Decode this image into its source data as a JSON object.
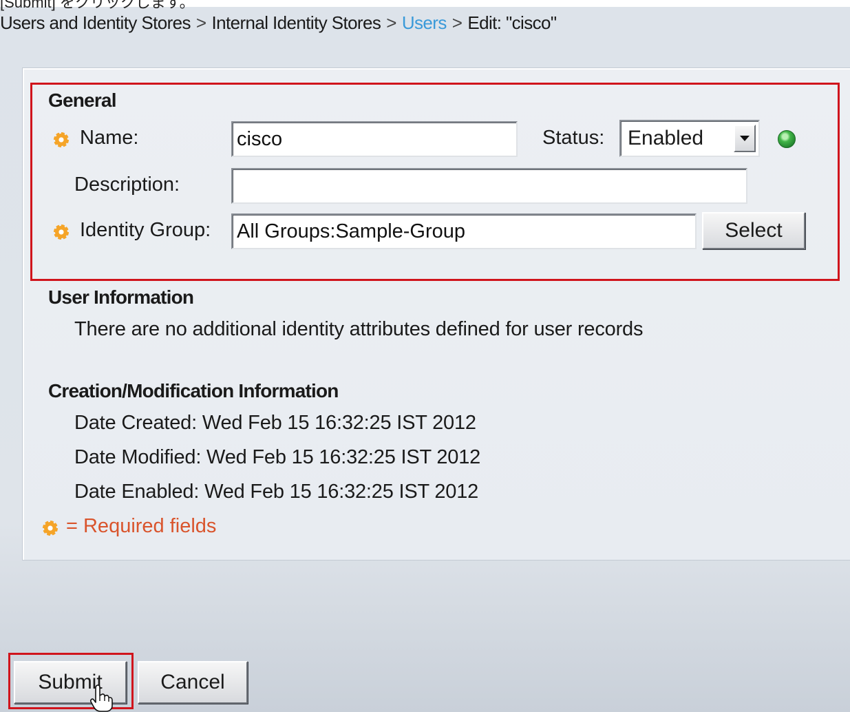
{
  "caption": "[Submit] をクリックします。",
  "breadcrumb": {
    "items": [
      "Users and Identity Stores",
      "Internal Identity Stores",
      "Users",
      "Edit: \"cisco\""
    ],
    "separator": ">"
  },
  "general": {
    "title": "General",
    "name_label": "Name:",
    "name_value": "cisco",
    "status_label": "Status:",
    "status_value": "Enabled",
    "description_label": "Description:",
    "description_value": "",
    "identity_group_label": "Identity Group:",
    "identity_group_value": "All Groups:Sample-Group",
    "select_button": "Select"
  },
  "user_information": {
    "title": "User Information",
    "text": "There are no additional identity attributes defined for user records"
  },
  "creation_info": {
    "title": "Creation/Modification Information",
    "date_created_label": "Date Created:",
    "date_created": "Wed Feb 15 16:32:25 IST 2012",
    "date_modified_label": "Date Modified:",
    "date_modified": "Wed Feb 15 16:32:25 IST 2012",
    "date_enabled_label": "Date Enabled:",
    "date_enabled": "Wed Feb 15 16:32:25 IST 2012"
  },
  "required_note": "= Required fields",
  "buttons": {
    "submit": "Submit",
    "cancel": "Cancel"
  },
  "colors": {
    "highlight": "#d0141c",
    "link": "#3a9ad9",
    "required": "#d9542c",
    "status_ok": "#42b548"
  },
  "icons": {
    "required": "required-asterisk-icon",
    "status": "status-enabled-icon",
    "cursor": "hand-cursor-icon"
  }
}
